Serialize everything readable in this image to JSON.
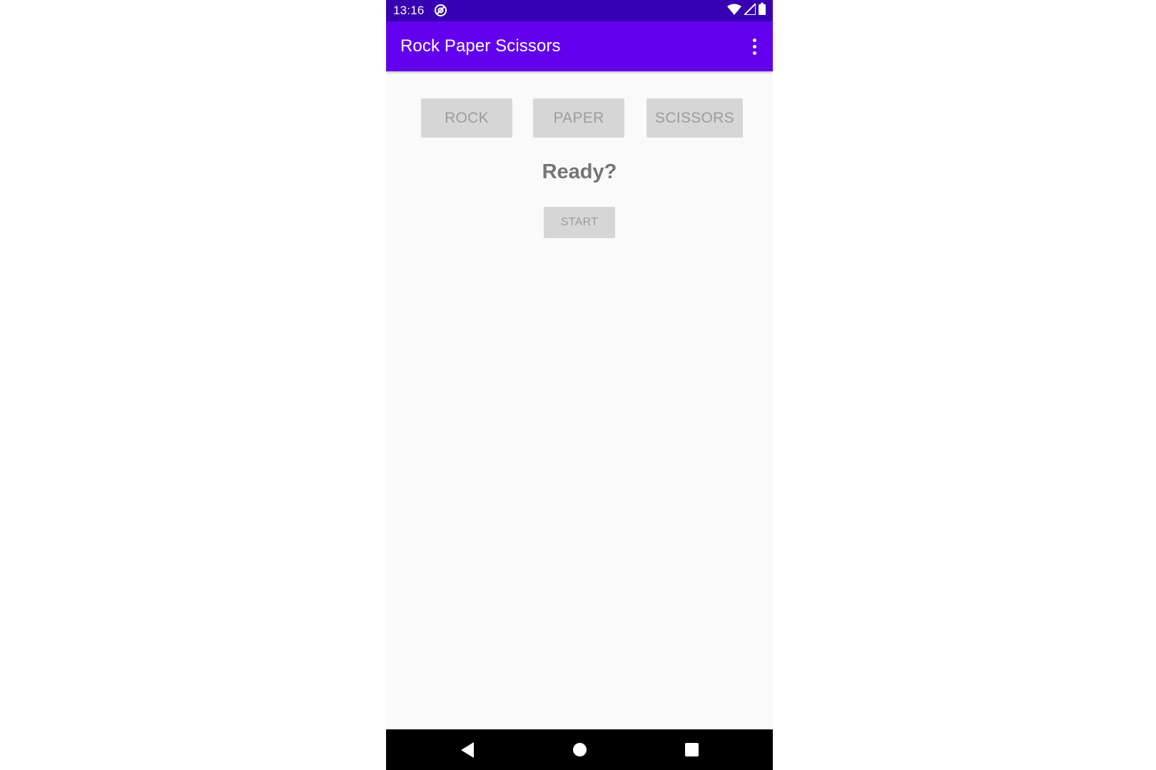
{
  "status_bar": {
    "time": "13:16",
    "notification_icon": "at-sign-icon",
    "right_icons": [
      "wifi-icon",
      "signal-icon",
      "battery-icon"
    ]
  },
  "app_bar": {
    "title": "Rock Paper Scissors",
    "overflow_icon": "more-vert-icon"
  },
  "choices": {
    "rock_label": "ROCK",
    "paper_label": "PAPER",
    "scissors_label": "SCISSORS",
    "enabled": false
  },
  "game": {
    "status": "Ready?",
    "start_label": "START",
    "start_enabled": false
  },
  "nav_bar": {
    "icons": [
      "back-icon",
      "home-icon",
      "recents-icon"
    ]
  },
  "colors": {
    "status_bar": "#3700b3",
    "app_bar": "#6200ee",
    "disabled_button": "#d6d6d6",
    "disabled_text": "#9c9c9c",
    "status_text": "#757575",
    "background": "#fafafa"
  }
}
